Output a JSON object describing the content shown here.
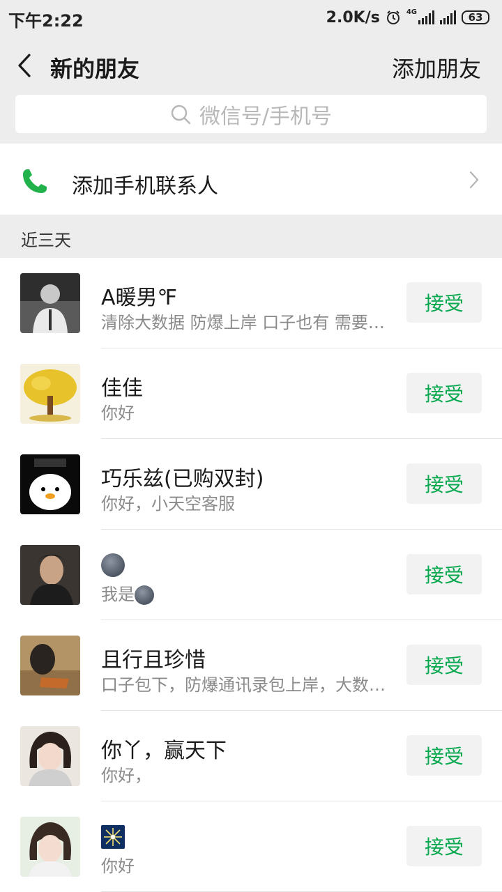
{
  "status": {
    "time": "下午2:22",
    "speed": "2.0K/s",
    "network": "4G",
    "battery": "63"
  },
  "header": {
    "title": "新的朋友",
    "add_friend": "添加朋友"
  },
  "search": {
    "placeholder": "微信号/手机号"
  },
  "phone_contacts": {
    "label": "添加手机联系人"
  },
  "section": {
    "label": "近三天"
  },
  "requests": [
    {
      "name": "A暖男℉",
      "message": "清除大数据   防爆上岸   口子也有   需要的联系",
      "accept": "接受"
    },
    {
      "name": "佳佳",
      "message": "你好",
      "accept": "接受"
    },
    {
      "name": "巧乐兹(已购双封)",
      "message": "你好，小天空客服",
      "accept": "接受"
    },
    {
      "name": "",
      "message": "我是",
      "accept": "接受"
    },
    {
      "name": "且行且珍惜",
      "message": "口子包下，防爆通讯录包上岸，大数据清除",
      "accept": "接受"
    },
    {
      "name": "你丫，赢天下",
      "message": "你好，",
      "accept": "接受"
    },
    {
      "name": "",
      "message": "你好",
      "accept": "接受"
    }
  ],
  "icons": {
    "back": "back-arrow-icon",
    "search": "search-icon",
    "phone": "phone-icon",
    "chevron": "chevron-right-icon"
  },
  "colors": {
    "accent": "#07a84e",
    "header_bg": "#ededed",
    "accept_bg": "#f2f2f2"
  }
}
